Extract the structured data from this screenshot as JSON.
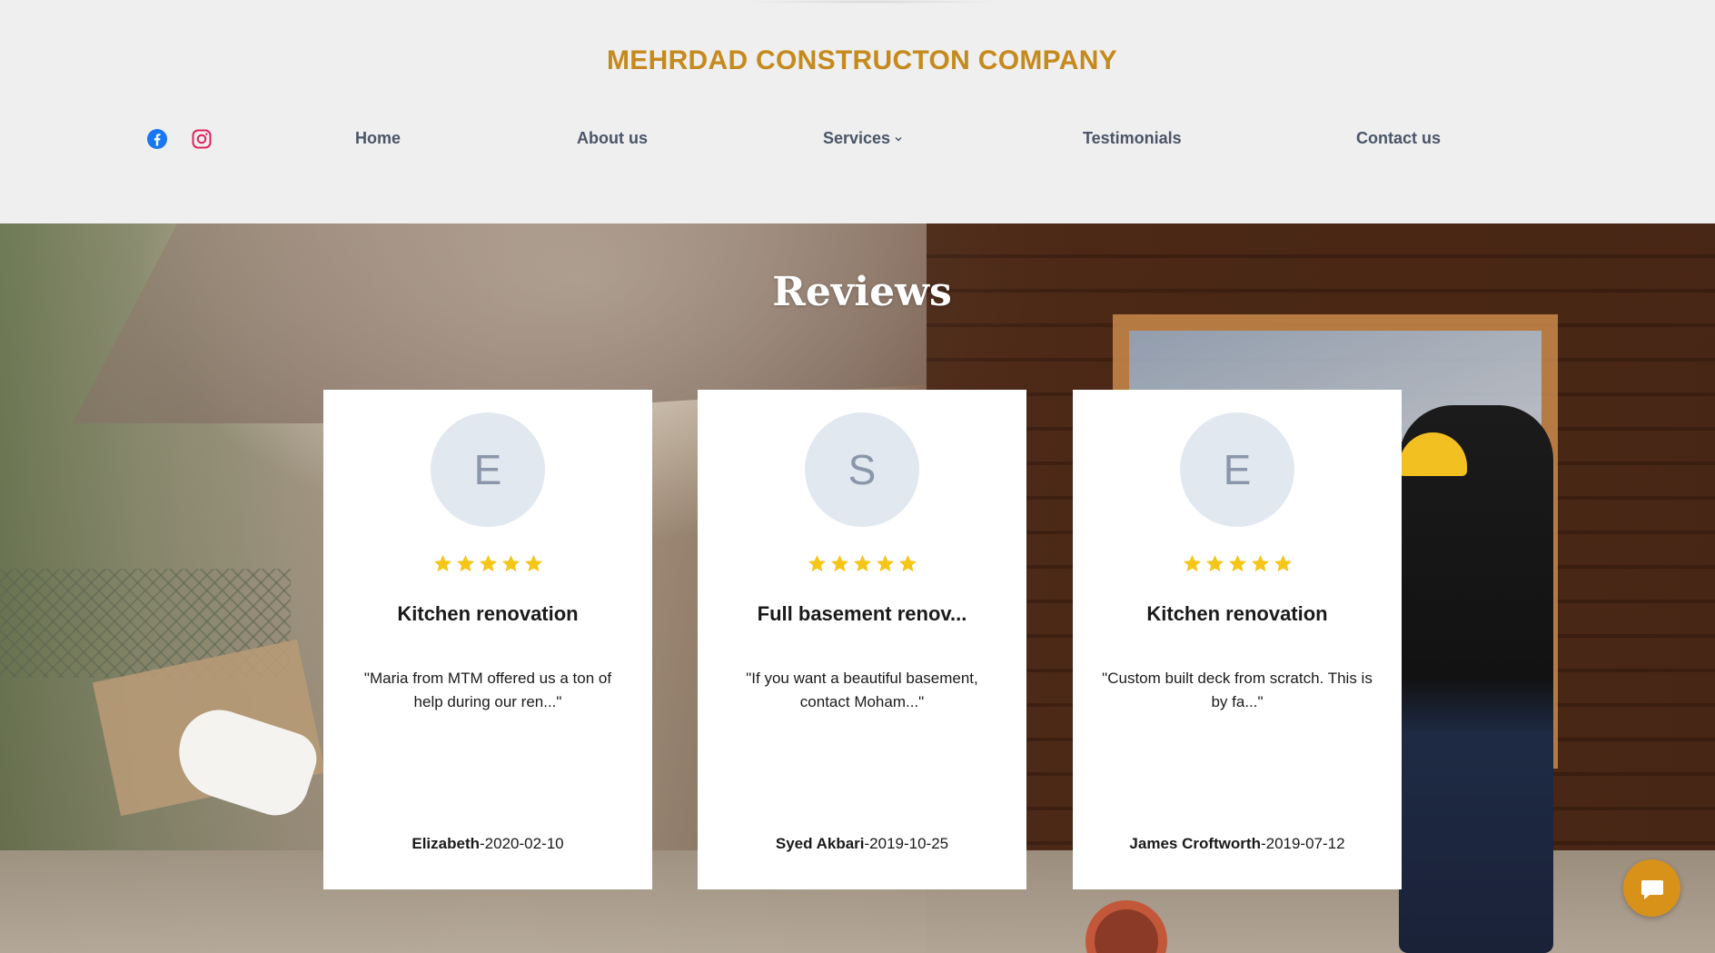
{
  "header": {
    "brand": "MEHRDAD CONSTRUCTON COMPANY",
    "social": [
      {
        "icon": "facebook-icon",
        "color": "#1877f2"
      },
      {
        "icon": "instagram-icon",
        "color": "#e1306c"
      }
    ],
    "nav": {
      "home": "Home",
      "about": "About us",
      "services": "Services",
      "testimonials": "Testimonials",
      "contact": "Contact us"
    }
  },
  "reviews": {
    "title": "Reviews",
    "cards": [
      {
        "initial": "E",
        "rating": 5,
        "title": "Kitchen renovation",
        "text": "\"Maria from MTM offered us a ton of help during our ren...\"",
        "author": "Elizabeth",
        "date": "-2020-02-10"
      },
      {
        "initial": "S",
        "rating": 5,
        "title": "Full basement renov...",
        "text": "\"If you want a beautiful basement, contact Moham...\"",
        "author": "Syed Akbari",
        "date": "-2019-10-25"
      },
      {
        "initial": "E",
        "rating": 5,
        "title": "Kitchen renovation",
        "text": "\"Custom built deck from scratch. This is by fa...\"",
        "author": "James Croftworth",
        "date": "-2019-07-12"
      }
    ]
  },
  "chat": {
    "icon": "chat-icon"
  },
  "colors": {
    "brand": "#c58a1d",
    "nav_text": "#4a5568",
    "star": "#f5c518",
    "avatar_bg": "#e2e8f0",
    "chat_button": "#d8921a"
  }
}
